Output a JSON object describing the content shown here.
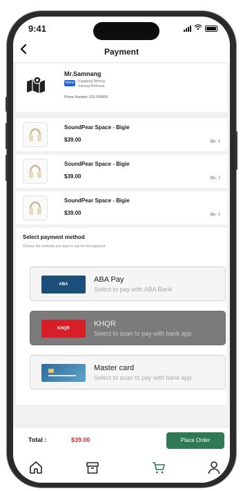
{
  "status_bar": {
    "time": "9:41"
  },
  "header": {
    "title": "Payment",
    "back_icon": "chevron-left-icon"
  },
  "address": {
    "name": "Mr.Samnang",
    "badge": "Home",
    "line1": "Kaggiang Mening",
    "line2": "Sakung Bonkraat",
    "phone": "Phone Number: 016 000000",
    "icon": "map-pin-icon"
  },
  "cart": {
    "items": [
      {
        "name": "SoundPear Space - Bigie",
        "price": "$39.00",
        "qty": "Qty : 1"
      },
      {
        "name": "SoundPear Space - Bigie",
        "price": "$39.00",
        "qty": "Qty : 1"
      },
      {
        "name": "SoundPear Space - Bigie",
        "price": "$39.00",
        "qty": "Qty : 1"
      }
    ]
  },
  "payment": {
    "title": "Select payment method",
    "subtitle": "Choose the methods you want to use for this payment",
    "methods": [
      {
        "name": "ABA Pay",
        "description": "Select to pay with ABA Bank",
        "logo_text": "ABA",
        "logo_color": "#1b4f7a",
        "selected": false
      },
      {
        "name": "KHQR",
        "description": "Select to scan to pay with bank app",
        "logo_text": "KHQR",
        "logo_color": "#d61f26",
        "selected": true
      },
      {
        "name": "Master card",
        "description": "Select to scan to pay with bank app",
        "logo_text": "",
        "logo_color": "#2c6a9c",
        "selected": false
      }
    ]
  },
  "footer": {
    "total_label": "Total :",
    "total_value": "$39.00",
    "place_order_label": "Place Order"
  },
  "colors": {
    "accent": "#2f7a55",
    "price_red": "#d32f2f",
    "selected_method": "#7b7b7b",
    "active_tab": "#2f7a55"
  },
  "tabbar": {
    "tabs": [
      {
        "icon": "home-icon",
        "active": false
      },
      {
        "icon": "orders-box-icon",
        "active": false
      },
      {
        "icon": "cart-icon",
        "active": true
      },
      {
        "icon": "profile-icon",
        "active": false
      }
    ]
  }
}
